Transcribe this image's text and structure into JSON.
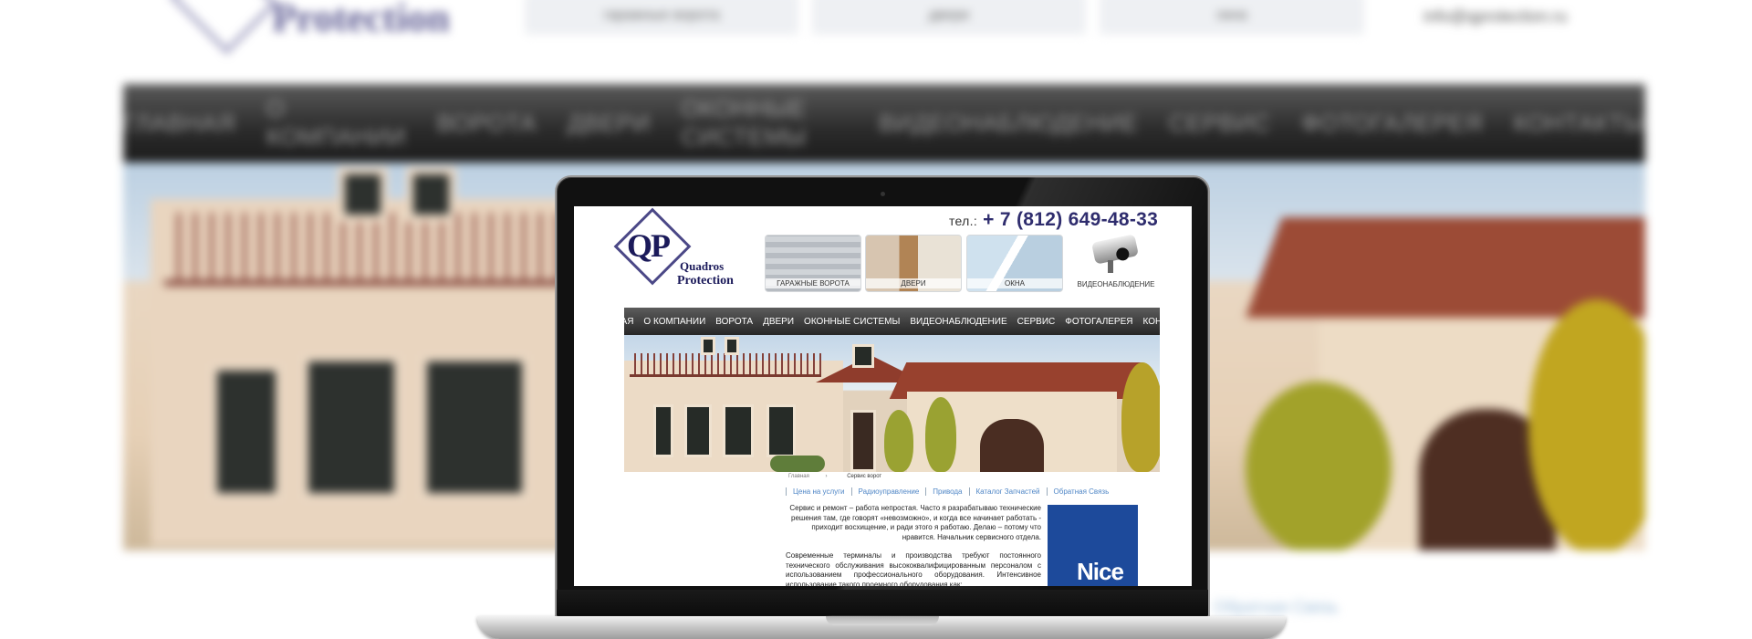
{
  "background": {
    "logo_text": "Protection",
    "top_thumbs": [
      "гаражные ворота",
      "двери",
      "окна"
    ],
    "email": "info@qprotection.ru",
    "nav": [
      "ГЛАВНАЯ",
      "О КОМПАНИИ",
      "ВОРОТА",
      "ДВЕРИ",
      "ОКОННЫЕ СИСТЕМЫ",
      "ВИДЕОНАБЛЮДЕНИЕ",
      "СЕРВИС",
      "ФОТОГАЛЕРЕЯ",
      "КОНТАКТЫ"
    ],
    "link": "Обратная Связь"
  },
  "site": {
    "phone_prefix": "тел.:",
    "phone": "+ 7 (812) 649-48-33",
    "logo": {
      "mark": "QP",
      "line1": "Quadros",
      "line2": "Protection"
    },
    "categories": [
      {
        "label": "ГАРАЖНЫЕ ВОРОТА"
      },
      {
        "label": "ДВЕРИ"
      },
      {
        "label": "ОКНА"
      },
      {
        "label": "ВИДЕОНАБЛЮДЕНИЕ"
      }
    ],
    "nav": [
      "ГЛАВНАЯ",
      "О КОМПАНИИ",
      "ВОРОТА",
      "ДВЕРИ",
      "ОКОННЫЕ СИСТЕМЫ",
      "ВИДЕОНАБЛЮДЕНИЕ",
      "СЕРВИС",
      "ФОТОГАЛЕРЕЯ",
      "КОНТАКТЫ"
    ],
    "breadcrumb": {
      "home": "Главная",
      "separator": "›",
      "current": "Сервис ворот"
    },
    "subnav": [
      "Цена на услуги",
      "Радиоуправление",
      "Привода",
      "Каталог Запчастей",
      "Обратная Связь"
    ],
    "paragraph1": "Сервис и ремонт – работа непростая. Часто я разрабатываю технические решения там, где говорят «невозможно», и когда все начинает работать - приходит восхищение, и ради этого я работаю. Делаю – потому что нравится. Начальник сервисного отдела.",
    "paragraph2": "Современные терминалы и производства требуют постоянного технического обслуживания высококвалифицированным персоналом с использованием профессионального оборудования. Интенсивное использование такого проемного оборудования как:",
    "brand_banner": "Nice"
  },
  "colors": {
    "brand": "#2f2d6e",
    "nav_dark": "#262626",
    "link": "#4f86c6",
    "nice_blue": "#1d4a9b"
  }
}
